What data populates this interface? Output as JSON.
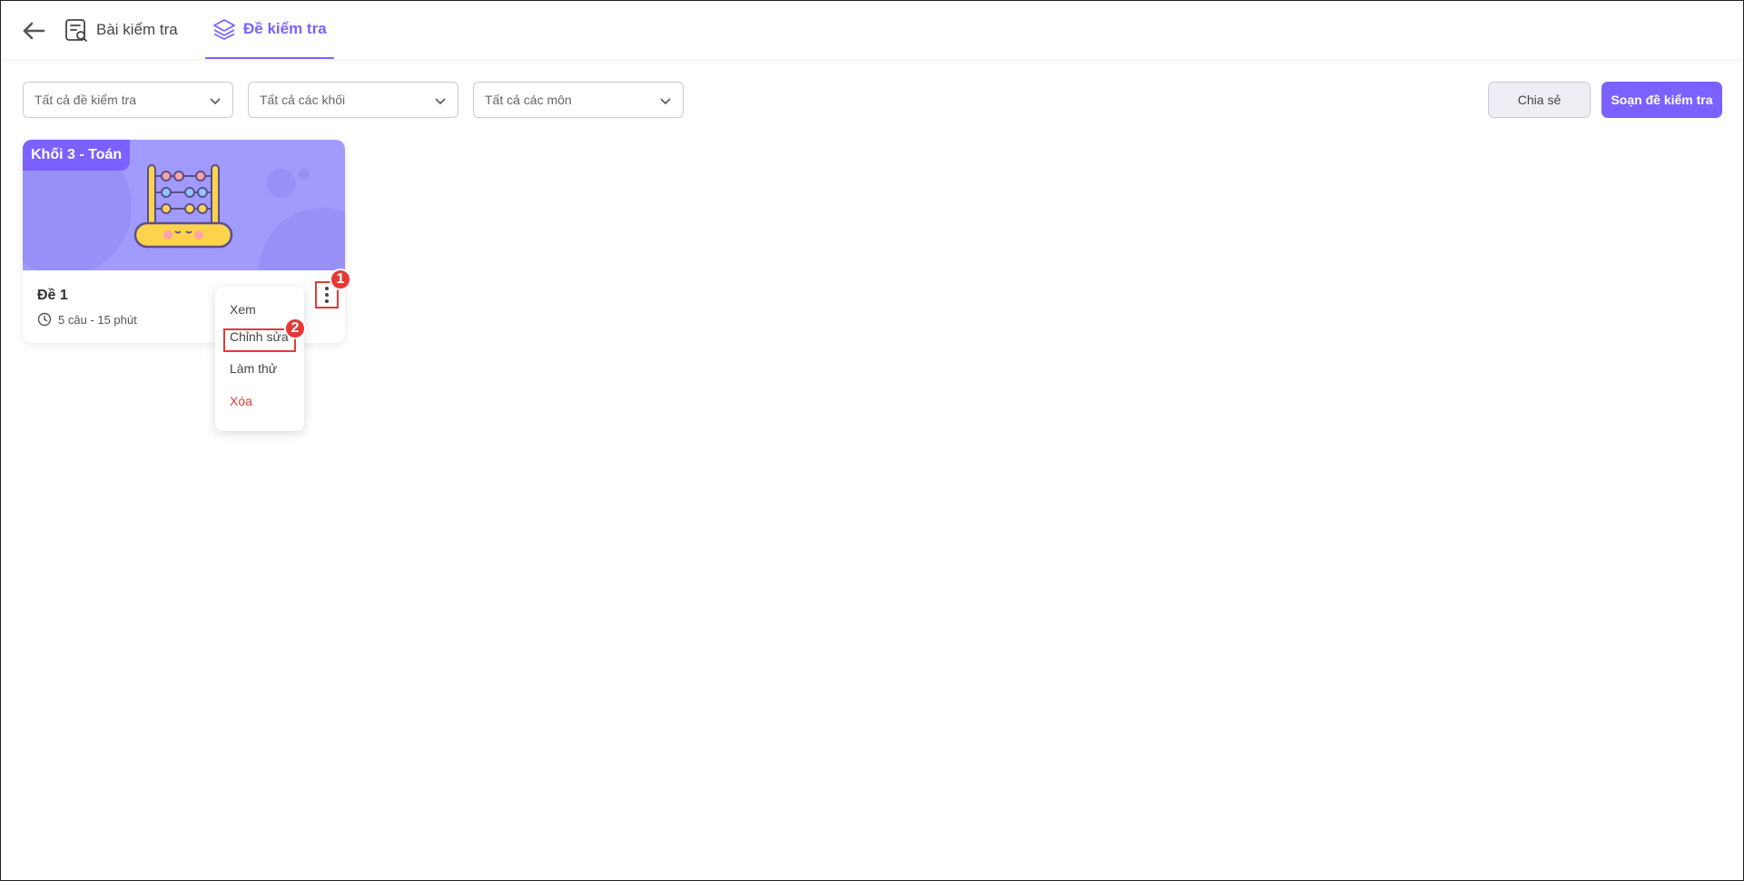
{
  "header": {
    "tabs": [
      {
        "label": "Bài kiểm tra",
        "active": false
      },
      {
        "label": "Đề kiểm tra",
        "active": true
      }
    ]
  },
  "filters": {
    "exam_set": "Tất cả đề kiểm tra",
    "grade": "Tất cả các khối",
    "subject": "Tất cả các môn"
  },
  "actions": {
    "share_label": "Chia sẻ",
    "compose_label": "Soạn đề kiểm tra"
  },
  "card": {
    "badge": "Khối 3 - Toán",
    "title": "Đề 1",
    "meta": "5 câu - 15 phút"
  },
  "menu": {
    "items": [
      "Xem",
      "Chỉnh sửa",
      "Làm thử",
      "Xóa"
    ]
  },
  "markers": [
    "1",
    "2"
  ],
  "colors": {
    "accent": "#7b61ff",
    "banner": "#a29bfe",
    "danger": "#e53935"
  }
}
